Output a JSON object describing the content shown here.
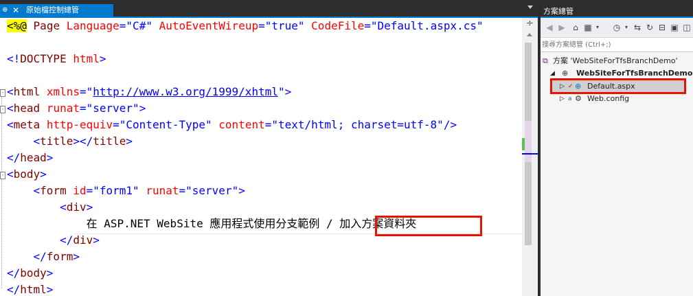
{
  "editor": {
    "tab": {
      "pin": "⊕",
      "close": "✕",
      "label": "原始檔控制總管"
    },
    "lines": [
      {
        "row": 0,
        "segments": [
          {
            "c": "t-asp",
            "t": "<%@"
          },
          {
            "c": "t-text",
            "t": " "
          },
          {
            "c": "t-tag",
            "t": "Page"
          },
          {
            "c": "t-text",
            "t": " "
          },
          {
            "c": "t-attr",
            "t": "Language"
          },
          {
            "c": "t-punct",
            "t": "="
          },
          {
            "c": "t-val",
            "t": "\"C#\""
          },
          {
            "c": "t-text",
            "t": " "
          },
          {
            "c": "t-attr",
            "t": "AutoEventWireup"
          },
          {
            "c": "t-punct",
            "t": "="
          },
          {
            "c": "t-val",
            "t": "\"true\""
          },
          {
            "c": "t-text",
            "t": " "
          },
          {
            "c": "t-attr",
            "t": "CodeFile"
          },
          {
            "c": "t-punct",
            "t": "="
          },
          {
            "c": "t-val",
            "t": "\"Default.aspx.cs\""
          }
        ]
      },
      {
        "row": 2,
        "segments": [
          {
            "c": "t-punct",
            "t": "<!"
          },
          {
            "c": "t-tag",
            "t": "DOCTYPE"
          },
          {
            "c": "t-text",
            "t": " "
          },
          {
            "c": "t-attr",
            "t": "html"
          },
          {
            "c": "t-punct",
            "t": ">"
          }
        ]
      },
      {
        "row": 4,
        "segments": [
          {
            "c": "t-punct",
            "t": "<"
          },
          {
            "c": "t-tag",
            "t": "html"
          },
          {
            "c": "t-text",
            "t": " "
          },
          {
            "c": "t-attr",
            "t": "xmlns"
          },
          {
            "c": "t-punct",
            "t": "=\""
          },
          {
            "c": "t-link",
            "t": "http://www.w3.org/1999/xhtml"
          },
          {
            "c": "t-punct",
            "t": "\">"
          }
        ]
      },
      {
        "row": 5,
        "segments": [
          {
            "c": "t-punct",
            "t": "<"
          },
          {
            "c": "t-tag",
            "t": "head"
          },
          {
            "c": "t-text",
            "t": " "
          },
          {
            "c": "t-attr",
            "t": "runat"
          },
          {
            "c": "t-punct",
            "t": "="
          },
          {
            "c": "t-val",
            "t": "\"server\""
          },
          {
            "c": "t-punct",
            "t": ">"
          }
        ]
      },
      {
        "row": 6,
        "segments": [
          {
            "c": "t-punct",
            "t": "<"
          },
          {
            "c": "t-tag",
            "t": "meta"
          },
          {
            "c": "t-text",
            "t": " "
          },
          {
            "c": "t-attr",
            "t": "http-equiv"
          },
          {
            "c": "t-punct",
            "t": "="
          },
          {
            "c": "t-val",
            "t": "\"Content-Type\""
          },
          {
            "c": "t-text",
            "t": " "
          },
          {
            "c": "t-attr",
            "t": "content"
          },
          {
            "c": "t-punct",
            "t": "="
          },
          {
            "c": "t-val",
            "t": "\"text/html; charset=utf-8\""
          },
          {
            "c": "t-punct",
            "t": "/>"
          }
        ]
      },
      {
        "row": 7,
        "segments": [
          {
            "c": "t-text",
            "t": "    "
          },
          {
            "c": "t-punct",
            "t": "<"
          },
          {
            "c": "t-tag",
            "t": "title"
          },
          {
            "c": "t-punct",
            "t": "></"
          },
          {
            "c": "t-tag",
            "t": "title"
          },
          {
            "c": "t-punct",
            "t": ">"
          }
        ]
      },
      {
        "row": 8,
        "segments": [
          {
            "c": "t-punct",
            "t": "</"
          },
          {
            "c": "t-tag",
            "t": "head"
          },
          {
            "c": "t-punct",
            "t": ">"
          }
        ]
      },
      {
        "row": 9,
        "segments": [
          {
            "c": "t-punct",
            "t": "<"
          },
          {
            "c": "t-tag",
            "t": "body"
          },
          {
            "c": "t-punct",
            "t": ">"
          }
        ]
      },
      {
        "row": 10,
        "segments": [
          {
            "c": "t-text",
            "t": "    "
          },
          {
            "c": "t-punct",
            "t": "<"
          },
          {
            "c": "t-tag",
            "t": "form"
          },
          {
            "c": "t-text",
            "t": " "
          },
          {
            "c": "t-attr",
            "t": "id"
          },
          {
            "c": "t-punct",
            "t": "="
          },
          {
            "c": "t-val",
            "t": "\"form1\""
          },
          {
            "c": "t-text",
            "t": " "
          },
          {
            "c": "t-attr",
            "t": "runat"
          },
          {
            "c": "t-punct",
            "t": "="
          },
          {
            "c": "t-val",
            "t": "\"server\""
          },
          {
            "c": "t-punct",
            "t": ">"
          }
        ]
      },
      {
        "row": 11,
        "segments": [
          {
            "c": "t-text",
            "t": "        "
          },
          {
            "c": "t-punct",
            "t": "<"
          },
          {
            "c": "t-tag",
            "t": "div"
          },
          {
            "c": "t-punct",
            "t": ">"
          }
        ]
      },
      {
        "row": 12,
        "segments": [
          {
            "c": "t-text",
            "t": "            在 ASP.NET WebSite 應用程式使用分支範例 / 加入方案資料夾"
          }
        ]
      },
      {
        "row": 13,
        "segments": [
          {
            "c": "t-text",
            "t": "        "
          },
          {
            "c": "t-punct",
            "t": "</"
          },
          {
            "c": "t-tag",
            "t": "div"
          },
          {
            "c": "t-punct",
            "t": ">"
          }
        ]
      },
      {
        "row": 14,
        "segments": [
          {
            "c": "t-text",
            "t": "    "
          },
          {
            "c": "t-punct",
            "t": "</"
          },
          {
            "c": "t-tag",
            "t": "form"
          },
          {
            "c": "t-punct",
            "t": ">"
          }
        ]
      },
      {
        "row": 15,
        "segments": [
          {
            "c": "t-punct",
            "t": "</"
          },
          {
            "c": "t-tag",
            "t": "body"
          },
          {
            "c": "t-punct",
            "t": ">"
          }
        ]
      },
      {
        "row": 16,
        "segments": [
          {
            "c": "t-punct",
            "t": "</"
          },
          {
            "c": "t-tag",
            "t": "html"
          },
          {
            "c": "t-punct",
            "t": ">"
          }
        ]
      }
    ],
    "split_glyph": "÷"
  },
  "solution_explorer": {
    "title": "方案總管",
    "search_placeholder": "搜尋方案總管 (Ctrl+;)",
    "toolbar_icons": [
      "back-icon",
      "forward-icon",
      "home-icon",
      "switch-views-icon",
      "pending-changes-filter-icon",
      "sync-icon",
      "refresh-icon",
      "collapse-all-icon",
      "properties-icon"
    ],
    "tree": {
      "solution": "方案 'WebSiteForTfsBranchDemo'",
      "website": "WebSiteForTfsBranchDemo",
      "file1": "Default.aspx",
      "file2": "Web.config"
    }
  },
  "colors": {
    "accent": "#007acc",
    "highlight_border": "#e51400",
    "chrome_dark": "#2d2d30"
  }
}
